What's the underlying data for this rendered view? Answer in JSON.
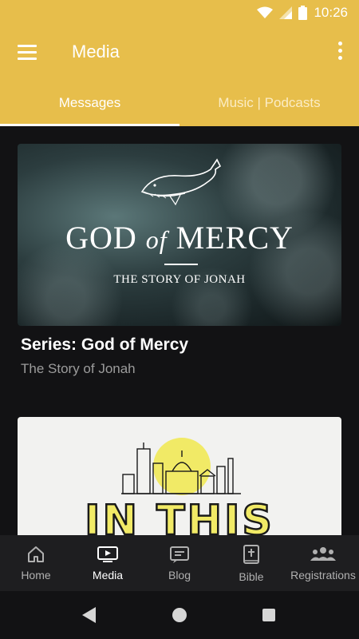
{
  "status_bar": {
    "time": "10:26"
  },
  "app_bar": {
    "title": "Media"
  },
  "tabs": [
    {
      "label": "Messages",
      "active": true
    },
    {
      "label": "Music | Podcasts",
      "active": false
    }
  ],
  "cards": [
    {
      "artwork": {
        "title_part1": "GOD",
        "title_part2": "of",
        "title_part3": "MERCY",
        "subtitle": "THE STORY OF JONAH"
      },
      "title": "Series: God of Mercy",
      "subtitle": "The Story of Jonah"
    },
    {
      "artwork": {
        "title": "IN THIS"
      }
    }
  ],
  "bottom_nav": [
    {
      "label": "Home",
      "icon": "home-icon",
      "active": false
    },
    {
      "label": "Media",
      "icon": "tv-play-icon",
      "active": true
    },
    {
      "label": "Blog",
      "icon": "blog-icon",
      "active": false
    },
    {
      "label": "Bible",
      "icon": "bible-icon",
      "active": false
    },
    {
      "label": "Registrations",
      "icon": "people-icon",
      "active": false
    }
  ],
  "colors": {
    "brand": "#e7be4b",
    "background": "#121214",
    "nav_background": "#1e1e20",
    "accent_yellow": "#f1ea66"
  }
}
